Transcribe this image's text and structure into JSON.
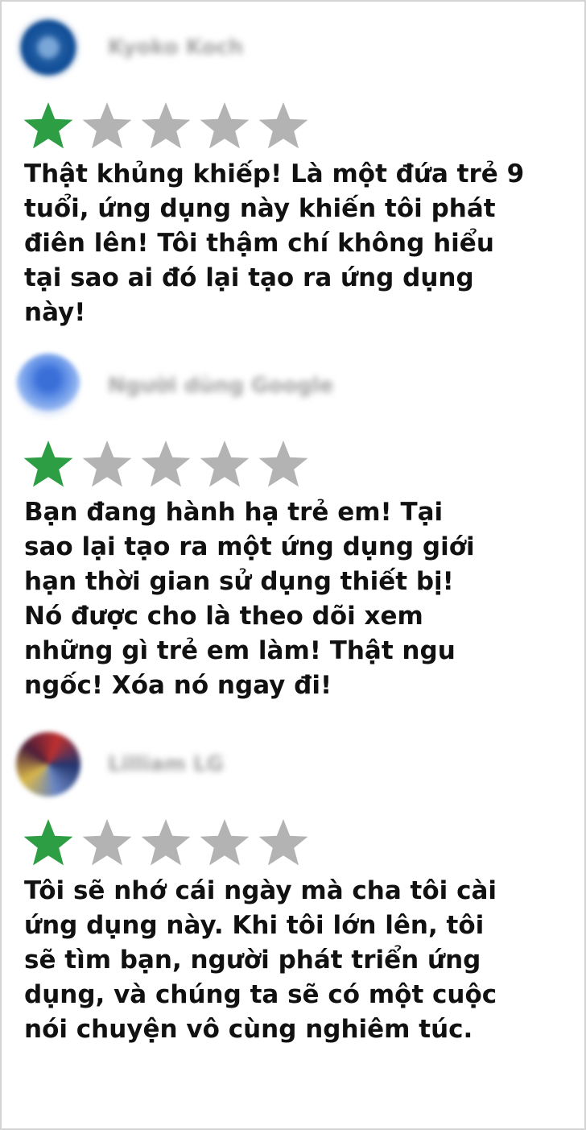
{
  "colors": {
    "star_filled": "#2e9e44",
    "star_empty": "#b3b3b3",
    "text": "#111111",
    "name_blurred": "#a3a3a3"
  },
  "reviews": [
    {
      "reviewer_name": "Kyoko Koch",
      "rating": 1,
      "max_rating": 5,
      "text": "Thật khủng khiếp! Là một đứa trẻ 9\ntuổi, ứng dụng này khiến tôi phát\nđiên lên! Tôi thậm chí không hiểu\ntại sao ai đó lại tạo ra ứng dụng\nnày!"
    },
    {
      "reviewer_name": "Người dùng Google",
      "rating": 1,
      "max_rating": 5,
      "text": "Bạn đang hành hạ trẻ em! Tại\nsao lại tạo ra một ứng dụng giới\nhạn thời gian sử dụng thiết bị!\nNó được cho là theo dõi xem\nnhững gì trẻ em làm! Thật ngu\nngốc! Xóa nó ngay đi!"
    },
    {
      "reviewer_name": "Lilliam LG",
      "rating": 1,
      "max_rating": 5,
      "text": "Tôi sẽ nhớ cái ngày mà cha tôi cài\nứng dụng này. Khi tôi lớn lên, tôi\nsẽ tìm bạn, người phát triển ứng\ndụng, và chúng ta sẽ có một cuộc\nnói chuyện vô cùng nghiêm túc."
    }
  ]
}
